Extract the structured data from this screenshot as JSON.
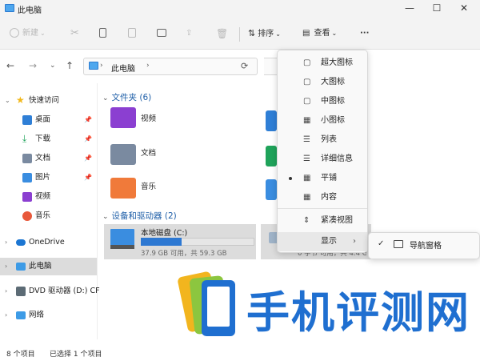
{
  "window": {
    "title": "此电脑",
    "minimize": "—",
    "maximize": "☐",
    "close": "✕"
  },
  "toolbar": {
    "new_label": "新建",
    "sort_label": "排序",
    "view_label": "查看",
    "more_label": "···"
  },
  "address": {
    "back": "←",
    "forward": "→",
    "recent": "⌄",
    "up": "↑",
    "path": "此电脑",
    "refresh": "⟳",
    "chevron": "›"
  },
  "sidebar": {
    "items": [
      {
        "label": "快速访问",
        "icon": "star-icon",
        "color": "#f2b81b"
      },
      {
        "label": "桌面",
        "icon": "desktop-icon",
        "color": "#2f7fd6"
      },
      {
        "label": "下载",
        "icon": "download-icon",
        "color": "#1fa35a"
      },
      {
        "label": "文档",
        "icon": "document-icon",
        "color": "#7a8aa0"
      },
      {
        "label": "图片",
        "icon": "pictures-icon",
        "color": "#3a8de0"
      },
      {
        "label": "视频",
        "icon": "videos-icon",
        "color": "#8b3fd1"
      },
      {
        "label": "音乐",
        "icon": "music-icon",
        "color": "#e8583a"
      },
      {
        "label": "OneDrive",
        "icon": "cloud-icon",
        "color": "#1c76d2"
      },
      {
        "label": "此电脑",
        "icon": "computer-icon",
        "color": "#3d9be6"
      },
      {
        "label": "DVD 驱动器 (D:) CF",
        "icon": "dvd-icon",
        "color": "#5c6b75"
      },
      {
        "label": "网络",
        "icon": "network-icon",
        "color": "#3d9be6"
      }
    ]
  },
  "main": {
    "folders_heading": "文件夹 (6)",
    "folders": [
      {
        "label": "视频",
        "color": "#8b3fd1"
      },
      {
        "label": "文档",
        "color": "#7a8aa0"
      },
      {
        "label": "音乐",
        "color": "#f07a3a"
      }
    ],
    "drives_heading": "设备和驱动器 (2)",
    "drive": {
      "name": "本地磁盘 (C:)",
      "detail": "37.9 GB 可用，共 59.3 GB",
      "used_fraction": 0.36
    },
    "drive2_detail": "0 字节 可用，共 4.4 GB"
  },
  "view_menu": {
    "items": [
      {
        "label": "超大图标",
        "icon": "▢"
      },
      {
        "label": "大图标",
        "icon": "▢"
      },
      {
        "label": "中图标",
        "icon": "▢"
      },
      {
        "label": "小图标",
        "icon": "▦"
      },
      {
        "label": "列表",
        "icon": "☰"
      },
      {
        "label": "详细信息",
        "icon": "☰"
      },
      {
        "label": "平铺",
        "icon": "▦"
      },
      {
        "label": "内容",
        "icon": "▦"
      },
      {
        "label": "紧凑视图",
        "icon": "⇕"
      }
    ],
    "selected": "平铺",
    "show_label": "显示",
    "show_chevron": "›"
  },
  "submenu": {
    "check": "✓",
    "label": "导航窗格"
  },
  "status": {
    "count": "8 个项目",
    "selected": "已选择 1 个项目"
  },
  "watermark": {
    "text": "手机评测网",
    "color": "#1f6fd0"
  }
}
